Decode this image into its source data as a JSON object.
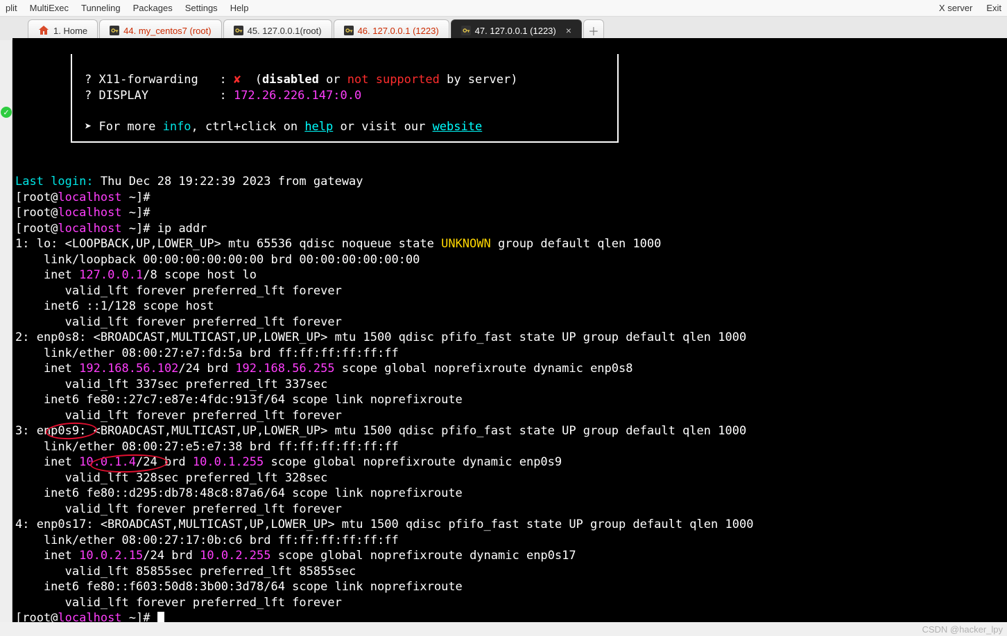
{
  "menu": {
    "items": [
      "plit",
      "MultiExec",
      "Tunneling",
      "Packages",
      "Settings",
      "Help"
    ],
    "right": [
      "X server",
      "Exit"
    ]
  },
  "tabs": [
    {
      "label": "1. Home",
      "icon": "home",
      "cls": ""
    },
    {
      "label": "44. my_centos7 (root)",
      "icon": "key",
      "cls": "red-text"
    },
    {
      "label": "45. 127.0.0.1(root)",
      "icon": "key",
      "cls": ""
    },
    {
      "label": "46. 127.0.0.1 (1223)",
      "icon": "key",
      "cls": "red-text"
    },
    {
      "label": "47. 127.0.0.1 (1223)",
      "icon": "key",
      "cls": "active"
    }
  ],
  "banner": {
    "x11_q": "? X11-forwarding   :",
    "x11_x": "✘",
    "x11_open": "(",
    "x11_disabled": "disabled",
    "x11_or": " or ",
    "x11_ns": "not supported",
    "x11_by": " by server)",
    "disp_q": "? DISPLAY          :",
    "disp_v": "172.26.226.147:0.0",
    "info_arrow": "➤ For more ",
    "info": "info",
    "info_mid": ", ctrl+click on ",
    "help": "help",
    "info_mid2": " or visit our ",
    "website": "website"
  },
  "login": {
    "label": "Last login:",
    "value": " Thu Dec 28 19:22:39 2023 from gateway"
  },
  "prompt": {
    "open": "[root@",
    "host": "localhost",
    "tail": " ~]# "
  },
  "cmd": "ip addr",
  "if1": {
    "head_a": "1: lo: <LOOPBACK,UP,LOWER_UP> mtu 65536 qdisc noqueue state ",
    "state": "UNKNOWN",
    "head_b": " group default qlen 1000",
    "link": "    link/loopback 00:00:00:00:00:00 brd 00:00:00:00:00:00",
    "inet_a": "    inet ",
    "inet_ip": "127.0.0.1",
    "inet_b": "/8 scope host lo",
    "valid": "       valid_lft forever preferred_lft forever",
    "inet6": "    inet6 ::1/128 scope host ",
    "valid6": "       valid_lft forever preferred_lft forever"
  },
  "if2": {
    "head": "2: enp0s8: <BROADCAST,MULTICAST,UP,LOWER_UP> mtu 1500 qdisc pfifo_fast state UP group default qlen 1000",
    "link": "    link/ether 08:00:27:e7:fd:5a brd ff:ff:ff:ff:ff:ff",
    "inet_a": "    inet ",
    "inet_ip": "192.168.56.102",
    "inet_mid": "/24 brd ",
    "inet_brd": "192.168.56.255",
    "inet_b": " scope global noprefixroute dynamic enp0s8",
    "valid": "       valid_lft 337sec preferred_lft 337sec",
    "inet6": "    inet6 fe80::27c7:e87e:4fdc:913f/64 scope link noprefixroute ",
    "valid6": "       valid_lft forever preferred_lft forever"
  },
  "if3": {
    "head": "3: enp0s9: <BROADCAST,MULTICAST,UP,LOWER_UP> mtu 1500 qdisc pfifo_fast state UP group default qlen 1000",
    "link": "    link/ether 08:00:27:e5:e7:38 brd ff:ff:ff:ff:ff:ff",
    "inet_a": "    inet ",
    "inet_ip": "10.0.1.4",
    "inet_mid": "/24 brd ",
    "inet_brd": "10.0.1.255",
    "inet_b": " scope global noprefixroute dynamic enp0s9",
    "valid": "       valid_lft 328sec preferred_lft 328sec",
    "inet6": "    inet6 fe80::d295:db78:48c8:87a6/64 scope link noprefixroute ",
    "valid6": "       valid_lft forever preferred_lft forever"
  },
  "if4": {
    "head": "4: enp0s17: <BROADCAST,MULTICAST,UP,LOWER_UP> mtu 1500 qdisc pfifo_fast state UP group default qlen 1000",
    "link": "    link/ether 08:00:27:17:0b:c6 brd ff:ff:ff:ff:ff:ff",
    "inet_a": "    inet ",
    "inet_ip": "10.0.2.15",
    "inet_mid": "/24 brd ",
    "inet_brd": "10.0.2.255",
    "inet_b": " scope global noprefixroute dynamic enp0s17",
    "valid": "       valid_lft 85855sec preferred_lft 85855sec",
    "inet6": "    inet6 fe80::f603:50d8:3b00:3d78/64 scope link noprefixroute ",
    "valid6": "       valid_lft forever preferred_lft forever"
  },
  "watermark": "CSDN @hacker_lpy"
}
